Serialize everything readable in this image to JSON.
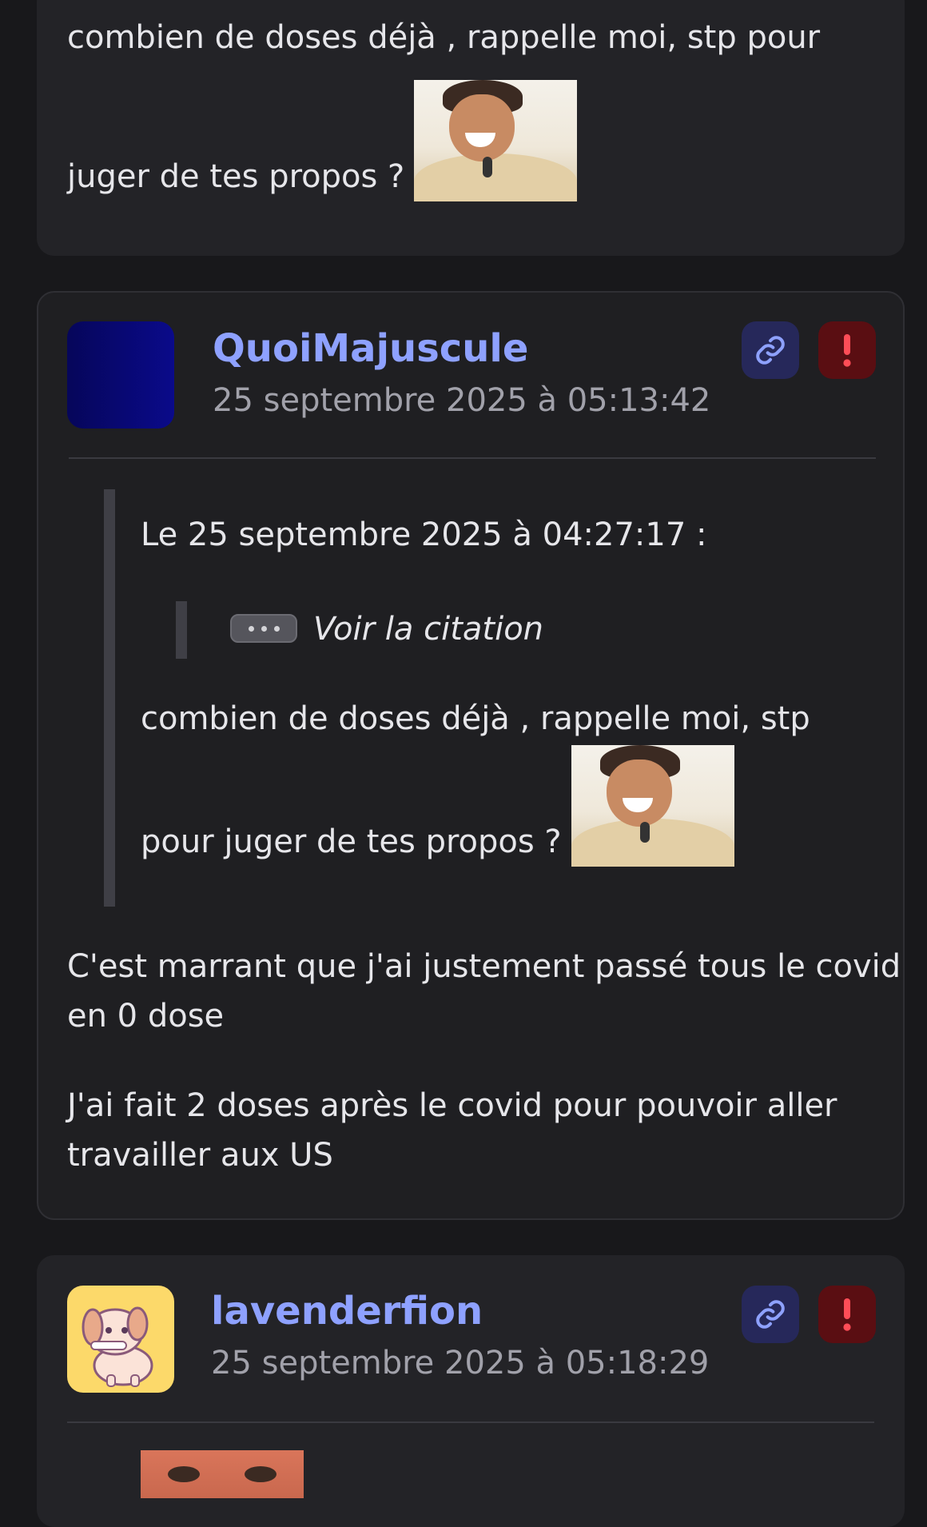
{
  "posts": [
    {
      "body_lines": [
        "combien de doses déjà , rappelle moi, stp pour",
        "juger de tes propos ?"
      ],
      "sticker": "laughing-man-sticker"
    },
    {
      "username": "QuoiMajuscule",
      "date": "25 septembre 2025 à 05:13:42",
      "quote": {
        "header": "Le 25 septembre 2025 à 04:27:17 :",
        "nested_label": "Voir la citation",
        "lines": [
          "combien de doses déjà , rappelle moi, stp",
          "pour juger de tes propos ?"
        ],
        "sticker": "laughing-man-sticker"
      },
      "paragraphs": [
        [
          "C'est marrant que j'ai justement passé tous le covid",
          "en 0 dose"
        ],
        [
          "J'ai fait 2 doses après le covid pour pouvoir aller",
          "travailler aux US"
        ]
      ]
    },
    {
      "username": "lavenderfion",
      "date": "25 septembre 2025 à 05:18:29"
    }
  ],
  "icons": {
    "link": "link-icon",
    "report": "exclamation-icon",
    "expand": "ellipsis-icon"
  },
  "colors": {
    "background": "#18181b",
    "card": "#232327",
    "username": "#8ea1ff",
    "link_button": "#26285a",
    "report_button": "#5a0e12",
    "report_icon": "#ff4d57"
  }
}
